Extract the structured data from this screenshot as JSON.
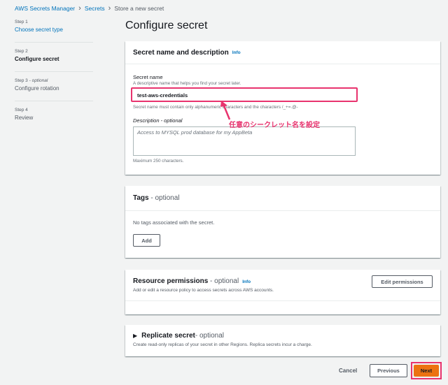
{
  "breadcrumb": {
    "items": [
      "AWS Secrets Manager",
      "Secrets"
    ],
    "current": "Store a new secret"
  },
  "steps": [
    {
      "num": "Step 1",
      "title": "Choose secret type"
    },
    {
      "num": "Step 2",
      "title": "Configure secret"
    },
    {
      "num": "Step 3",
      "optional": " - optional",
      "title": "Configure rotation"
    },
    {
      "num": "Step 4",
      "title": "Review"
    }
  ],
  "page_title": "Configure secret",
  "secret_panel": {
    "title": "Secret name and description",
    "info": "Info",
    "name_label": "Secret name",
    "name_desc": "A descriptive name that helps you find your secret later.",
    "name_value": "test-aws-credentials",
    "name_hint": "Secret name must contain only alphanumeric characters and the characters /_+=.@-",
    "desc_label": "Description - optional",
    "desc_placeholder": "Access to MYSQL prod database for my AppBeta",
    "desc_hint": "Maximum 250 characters."
  },
  "annotation": {
    "text": "任意のシークレット名を設定",
    "color": "#e8336e"
  },
  "tags_panel": {
    "title": "Tags",
    "optional": " - optional",
    "empty": "No tags associated with the secret.",
    "add_label": "Add"
  },
  "resource_panel": {
    "title": "Resource permissions",
    "optional": " - optional",
    "info": "Info",
    "desc": "Add or edit a resource policy to access secrets across AWS accounts.",
    "edit_label": "Edit permissions"
  },
  "replicate_panel": {
    "title": "Replicate secret",
    "optional": " - optional",
    "desc": "Create read-only replicas of your secret in other Regions. Replica secrets incur a charge."
  },
  "footer": {
    "cancel": "Cancel",
    "previous": "Previous",
    "next": "Next"
  },
  "colors": {
    "accent_orange": "#ec7211",
    "link_blue": "#0073bb",
    "annotation_pink": "#e8336e"
  }
}
